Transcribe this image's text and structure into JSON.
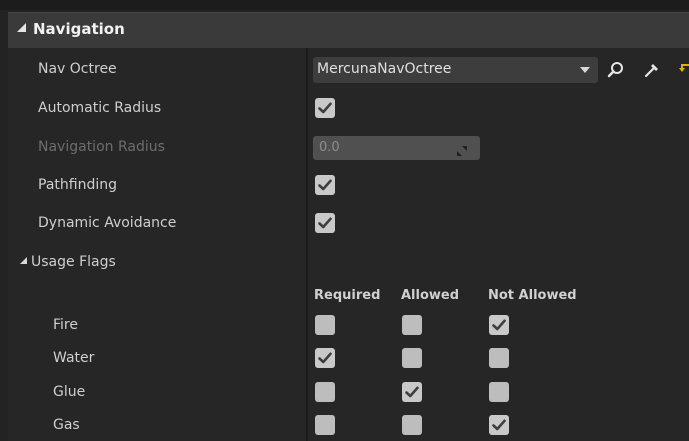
{
  "section": {
    "title": "Navigation"
  },
  "properties": {
    "nav_octree": {
      "label": "Nav Octree",
      "value": "MercunaNavOctree"
    },
    "automatic_radius": {
      "label": "Automatic Radius",
      "checked": true
    },
    "navigation_radius": {
      "label": "Navigation Radius",
      "value": "0.0",
      "disabled": true
    },
    "pathfinding": {
      "label": "Pathfinding",
      "checked": true
    },
    "dynamic_avoidance": {
      "label": "Dynamic Avoidance",
      "checked": true
    }
  },
  "usage_flags": {
    "label": "Usage Flags",
    "columns": [
      "Required",
      "Allowed",
      "Not Allowed"
    ],
    "rows": [
      {
        "name": "Fire",
        "required": false,
        "allowed": false,
        "not_allowed": true
      },
      {
        "name": "Water",
        "required": true,
        "allowed": false,
        "not_allowed": false
      },
      {
        "name": "Glue",
        "required": false,
        "allowed": true,
        "not_allowed": false
      },
      {
        "name": "Gas",
        "required": false,
        "allowed": false,
        "not_allowed": true
      }
    ]
  },
  "icons": {
    "combo_caret": "chevron-down-icon",
    "browse": "search-icon",
    "pick": "eyedropper-icon",
    "reset": "reset-arrow-icon",
    "expand": "expand-arrows-icon",
    "check": "checkmark-icon"
  },
  "colors": {
    "header_bg": "#3a3a3a",
    "panel_bg": "#262626",
    "checkbox": "#c9c9c9",
    "reset_icon": "#d9b300"
  }
}
